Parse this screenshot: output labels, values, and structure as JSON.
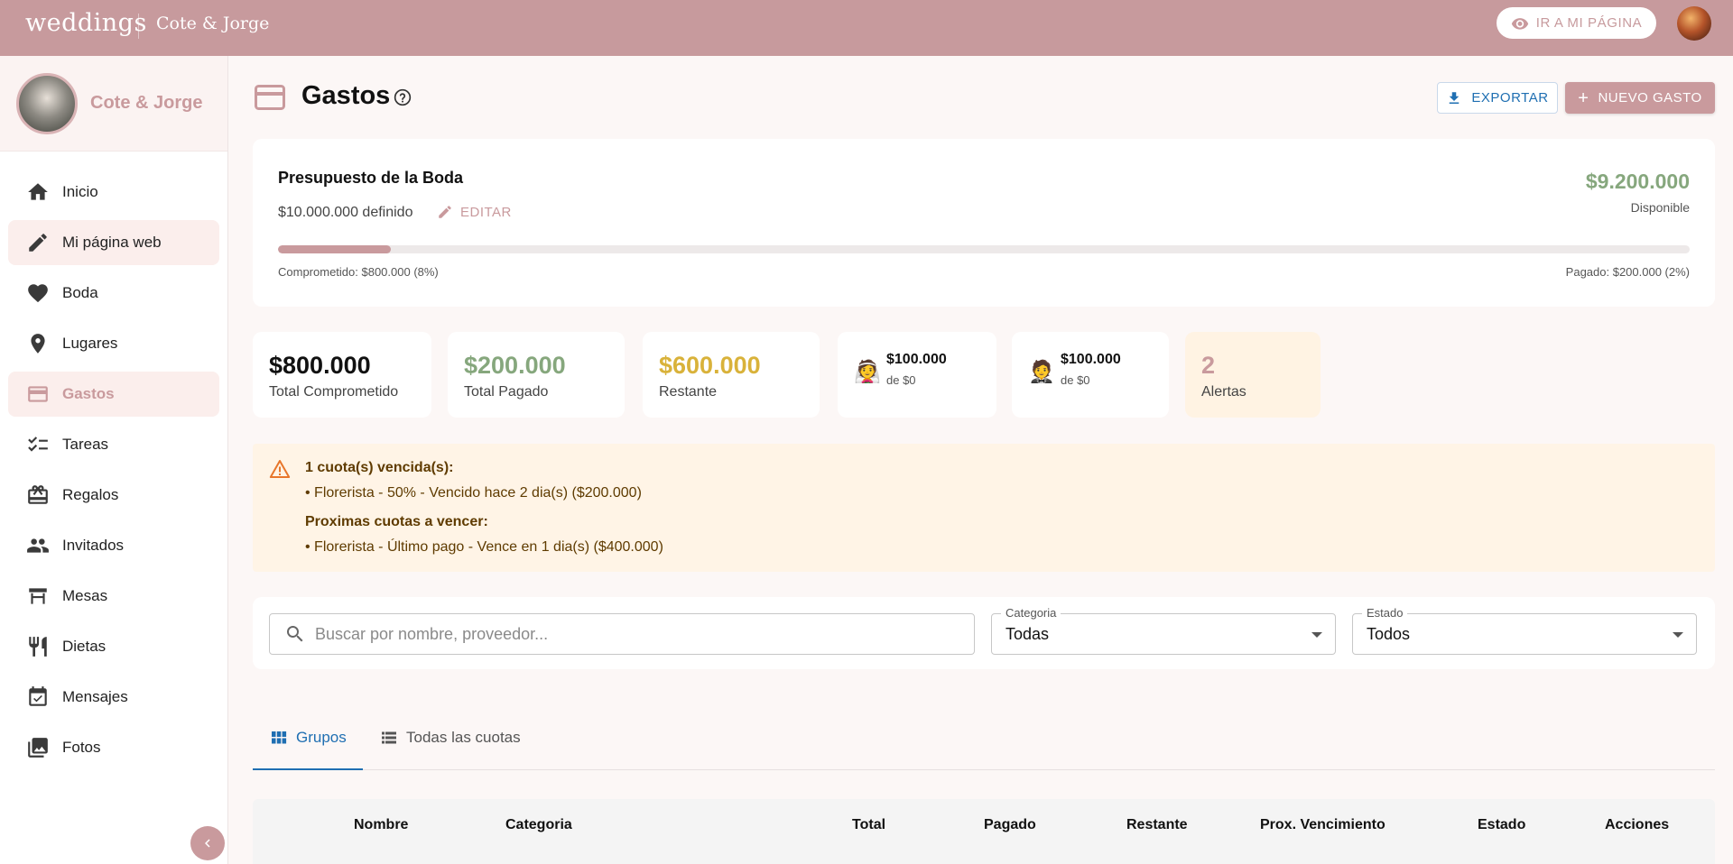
{
  "topbar": {
    "logo": "weddings",
    "couple": "Cote & Jorge",
    "my_page_button": "IR A MI PÁGINA"
  },
  "sidebar": {
    "profile_name": "Cote & Jorge",
    "items": [
      {
        "label": "Inicio",
        "icon": "home-icon"
      },
      {
        "label": "Mi página web",
        "icon": "pencil-icon"
      },
      {
        "label": "Boda",
        "icon": "heart-icon"
      },
      {
        "label": "Lugares",
        "icon": "location-pin-icon"
      },
      {
        "label": "Gastos",
        "icon": "credit-card-icon"
      },
      {
        "label": "Tareas",
        "icon": "checklist-icon"
      },
      {
        "label": "Regalos",
        "icon": "gift-icon"
      },
      {
        "label": "Invitados",
        "icon": "people-icon"
      },
      {
        "label": "Mesas",
        "icon": "table-icon"
      },
      {
        "label": "Dietas",
        "icon": "utensils-icon"
      },
      {
        "label": "Mensajes",
        "icon": "calendar-check-icon"
      },
      {
        "label": "Fotos",
        "icon": "photos-icon"
      }
    ],
    "active": "Gastos"
  },
  "header": {
    "title": "Gastos",
    "export_label": "EXPORTAR",
    "new_label": "NUEVO GASTO"
  },
  "budget": {
    "title": "Presupuesto de la Boda",
    "defined": "$10.000.000 definido",
    "edit_label": "EDITAR",
    "available_value": "$9.200.000",
    "available_label": "Disponible",
    "committed_fraction": 0.08,
    "committed_text": "Comprometido: $800.000 (8%)",
    "paid_text": "Pagado: $200.000 (2%)"
  },
  "stats": {
    "committed": {
      "value": "$800.000",
      "label": "Total Comprometido",
      "color": "#111111"
    },
    "paid": {
      "value": "$200.000",
      "label": "Total Pagado",
      "color": "#86a77d"
    },
    "remaining": {
      "value": "$600.000",
      "label": "Restante",
      "color": "#d9b23a"
    },
    "bride": {
      "emoji": "👰",
      "value": "$100.000",
      "label": "de $0"
    },
    "groom": {
      "emoji": "🤵",
      "value": "$100.000",
      "label": "de $0"
    },
    "alerts": {
      "value": "2",
      "label": "Alertas",
      "color": "#c99a9d"
    }
  },
  "alert_box": {
    "overdue_title": "1 cuota(s) vencida(s):",
    "overdue_item": "• Florerista - 50% - Vencido hace 2 dia(s) ($200.000)",
    "upcoming_title": "Proximas cuotas a vencer:",
    "upcoming_item": "• Florerista - Último pago - Vence en 1 dia(s) ($400.000)"
  },
  "filters": {
    "search_placeholder": "Buscar por nombre, proveedor...",
    "category_label": "Categoria",
    "category_value": "Todas",
    "status_label": "Estado",
    "status_value": "Todos"
  },
  "tabs": {
    "groups": "Grupos",
    "all_installments": "Todas las cuotas"
  },
  "table": {
    "columns": [
      "Nombre",
      "Categoria",
      "Total",
      "Pagado",
      "Restante",
      "Prox. Vencimiento",
      "Estado",
      "Acciones"
    ]
  }
}
